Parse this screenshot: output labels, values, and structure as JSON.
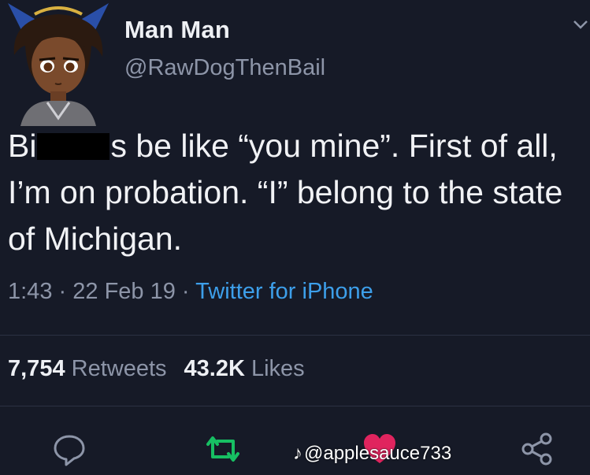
{
  "tweet": {
    "display_name": "Man Man",
    "handle": "@RawDogThenBail",
    "text_part1": "Bi",
    "text_part2": "s be like “you mine”. First of all, I’m on probation. “I” belong to the state of Michigan.",
    "time": "1:43",
    "date": "22 Feb 19",
    "separator": "·",
    "source": "Twitter for iPhone",
    "retweets_count": "7,754",
    "retweets_label": "Retweets",
    "likes_count": "43.2K",
    "likes_label": "Likes"
  },
  "watermark": {
    "logo": "♪",
    "handle": "@applesauce733"
  },
  "colors": {
    "background": "#161a27",
    "link": "#3d9fea",
    "muted": "#8d95a8",
    "retweet_icon": "#17bf63",
    "like_icon": "#e0245e"
  },
  "icons": [
    "reply-icon",
    "retweet-icon",
    "like-icon",
    "share-icon",
    "chevron-down-icon"
  ]
}
